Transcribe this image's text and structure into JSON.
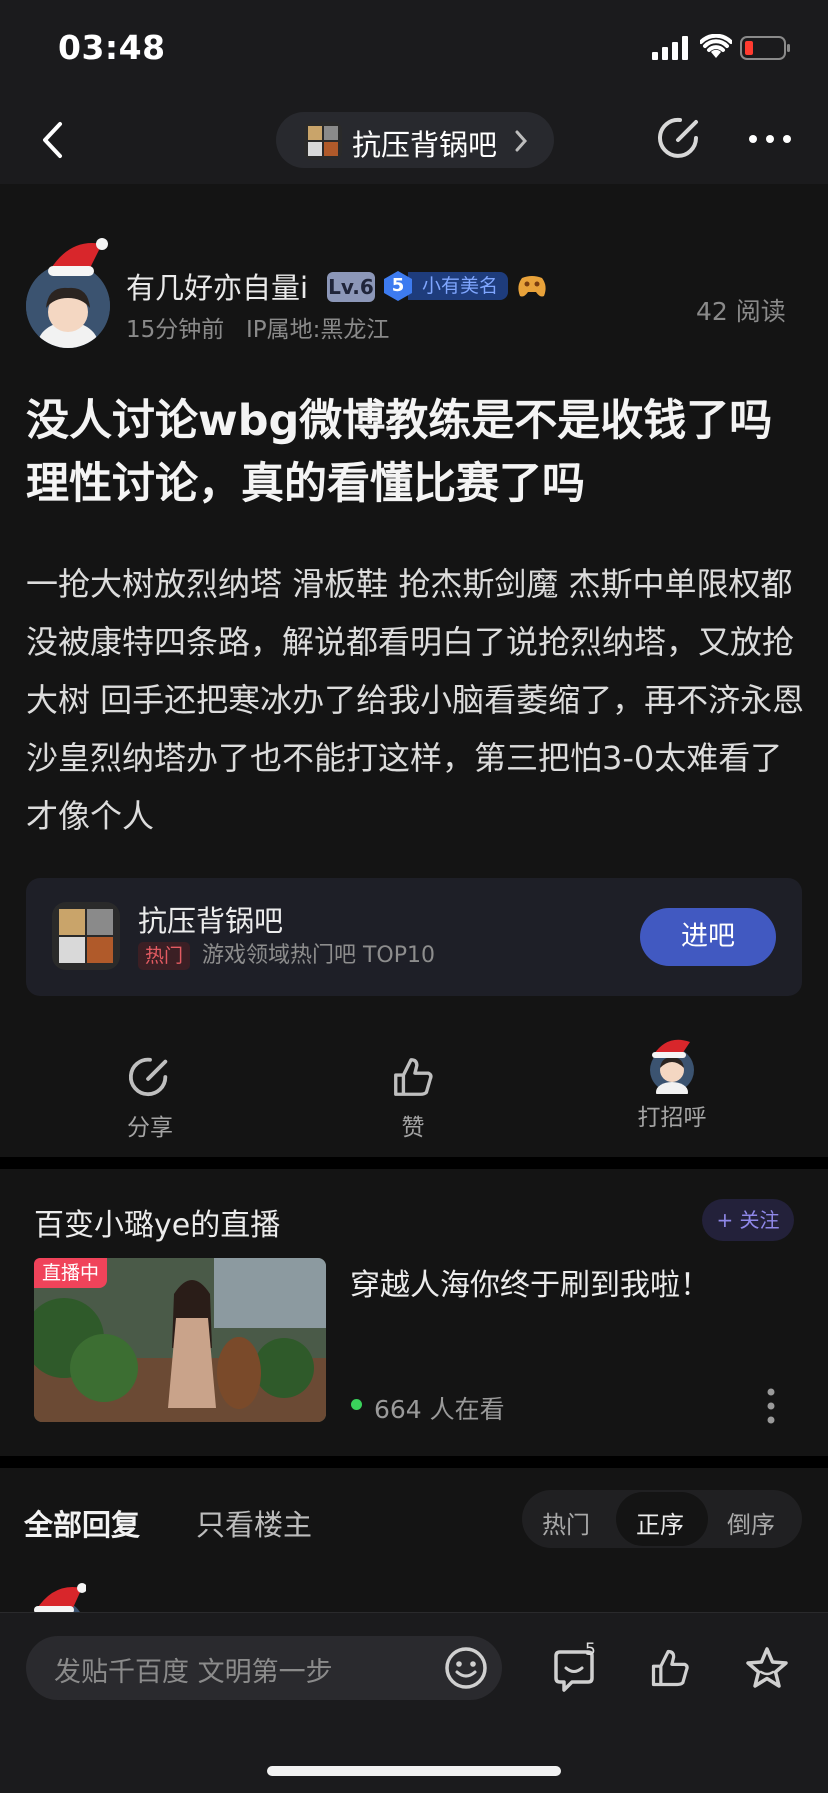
{
  "status_bar": {
    "time": "03:48"
  },
  "nav": {
    "bar_name": "抗压背锅吧"
  },
  "post": {
    "author": "有几好亦自量i",
    "level": "Lv.6",
    "badge_level": "5",
    "badge_label": "小有美名",
    "time_ago": "15分钟前",
    "ip": "IP属地:黑龙江",
    "reads": "42 阅读",
    "title": "没人讨论wbg微博教练是不是收钱了吗 理性讨论，真的看懂比赛了吗",
    "body": "一抢大树放烈纳塔 滑板鞋 抢杰斯剑魔 杰斯中单限权都没被康特四条路，解说都看明白了说抢烈纳塔，又放抢大树 回手还把寒冰办了给我小脑看萎缩了，再不济永恩沙皇烈纳塔办了也不能打这样，第三把怕3-0太难看了才像个人"
  },
  "forum_card": {
    "name": "抗压背锅吧",
    "hot_tag": "热门",
    "rank": "游戏领域热门吧 TOP10",
    "join_label": "进吧"
  },
  "actions": {
    "share": "分享",
    "like": "赞",
    "greet": "打招呼"
  },
  "live": {
    "title": "百变小璐ye的直播",
    "follow_label": "+ 关注",
    "badge": "直播中",
    "desc": "穿越人海你终于刷到我啦！",
    "viewers": "664 人在看"
  },
  "reply_tabs": {
    "all": "全部回复",
    "op_only": "只看楼主",
    "sort": {
      "hot": "热门",
      "asc": "正序",
      "desc": "倒序",
      "active": "正序"
    }
  },
  "bottom_bar": {
    "input_placeholder": "发贴千百度 文明第一步",
    "comment_count": "5"
  },
  "colors": {
    "background": "#141414",
    "accent_blue": "#4159c1",
    "live_red": "#f0435a",
    "hot_red": "#e35b62",
    "battery_red": "#ff3b30"
  }
}
